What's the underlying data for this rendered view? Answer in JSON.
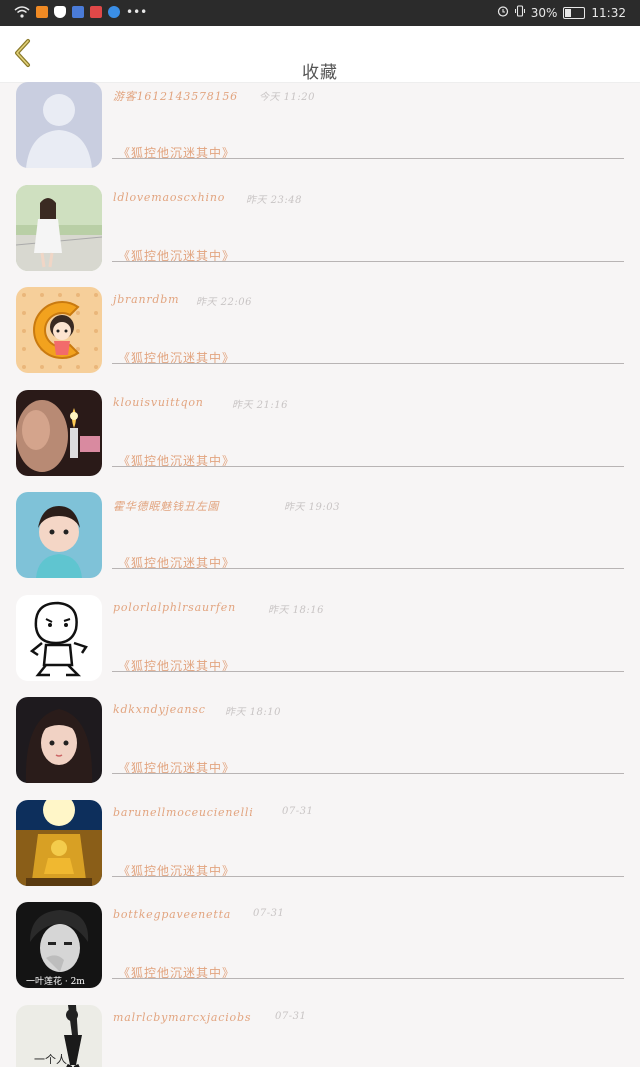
{
  "statusbar": {
    "battery_percent": "30%",
    "time": "11:32",
    "icons": [
      "wifi-icon",
      "app-icon-orange",
      "shield-icon",
      "app-icon-blue",
      "app-icon-red",
      "app-icon-location",
      "more-icon"
    ]
  },
  "header": {
    "back_icon": "chevron-left-icon",
    "title": "收藏"
  },
  "list": [
    {
      "name": "游客1612143578156",
      "time": "今天 11:20",
      "status": "《狐控他沉迷其中》",
      "avatar": "default-avatar"
    },
    {
      "name": "ldlovemaoscxhino",
      "time": "昨天 23:48",
      "status": "《狐控他沉迷其中》",
      "avatar": "girl-photo"
    },
    {
      "name": "jbranrdbm",
      "time": "昨天 22:06",
      "status": "《狐控他沉迷其中》",
      "avatar": "cartoon-c-avatar"
    },
    {
      "name": "klouisvuittqon",
      "time": "昨天 21:16",
      "status": "《狐控他沉迷其中》",
      "avatar": "smoking-photo"
    },
    {
      "name": "霍华德眠魅钱丑左園",
      "time": "昨天 19:03",
      "status": "《狐控他沉迷其中》",
      "avatar": "child-photo"
    },
    {
      "name": "polorlalphlrsaurfen",
      "time": "昨天 18:16",
      "status": "《狐控他沉迷其中》",
      "avatar": "cartoon-baby"
    },
    {
      "name": "kdkxndyjeansc",
      "time": "昨天 18:10",
      "status": "《狐控他沉迷其中》",
      "avatar": "girl-selfie"
    },
    {
      "name": "barunellmoceucienelli",
      "time": "07-31",
      "status": "《狐控他沉迷其中》",
      "avatar": "buddha-photo"
    },
    {
      "name": "bottkegpaveenetta",
      "time": "07-31",
      "status": "《狐控他沉迷其中》",
      "avatar": "bw-boy-photo"
    },
    {
      "name": "malrlcbymarcxjaciobs",
      "time": "07-31",
      "status": "《狐控他沉迷其中》",
      "avatar": "bw-figure-photo"
    }
  ],
  "avatar_text": {
    "bw_boy": "一叶莲花 · 2m",
    "bw_figure": "一个人"
  },
  "colors": {
    "accent": "#e2a47f",
    "header_bg": "#ffffff",
    "page_bg": "#f7f5f5",
    "status_bar": "#2b2b2b"
  }
}
